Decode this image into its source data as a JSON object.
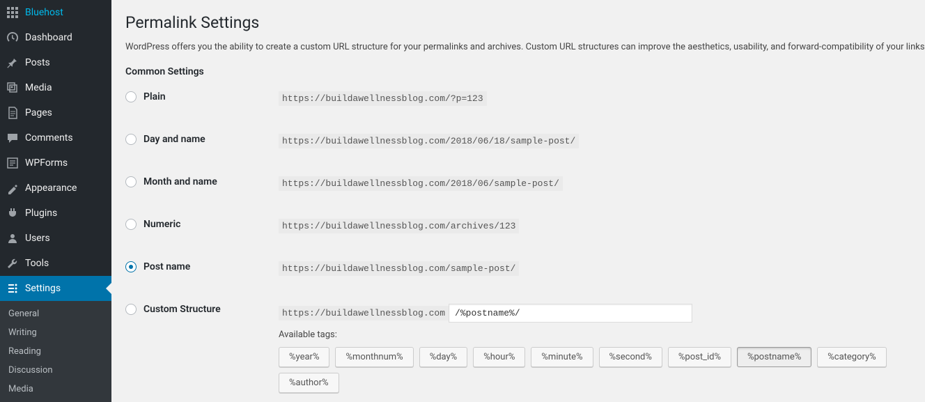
{
  "sidebar": {
    "items": [
      {
        "label": "Bluehost",
        "icon": "grid"
      },
      {
        "label": "Dashboard",
        "icon": "dashboard"
      },
      {
        "label": "Posts",
        "icon": "pin"
      },
      {
        "label": "Media",
        "icon": "media"
      },
      {
        "label": "Pages",
        "icon": "pages"
      },
      {
        "label": "Comments",
        "icon": "comments"
      },
      {
        "label": "WPForms",
        "icon": "forms"
      },
      {
        "label": "Appearance",
        "icon": "appearance"
      },
      {
        "label": "Plugins",
        "icon": "plugins"
      },
      {
        "label": "Users",
        "icon": "users"
      },
      {
        "label": "Tools",
        "icon": "tools"
      },
      {
        "label": "Settings",
        "icon": "settings",
        "active": true
      }
    ],
    "submenu": [
      {
        "label": "General"
      },
      {
        "label": "Writing"
      },
      {
        "label": "Reading"
      },
      {
        "label": "Discussion"
      },
      {
        "label": "Media"
      }
    ]
  },
  "main": {
    "title": "Permalink Settings",
    "description": "WordPress offers you the ability to create a custom URL structure for your permalinks and archives. Custom URL structures can improve the aesthetics, usability, and forward-compatibility of your links. A",
    "section_heading": "Common Settings",
    "options": [
      {
        "label": "Plain",
        "sample": "https://buildawellnessblog.com/?p=123",
        "checked": false
      },
      {
        "label": "Day and name",
        "sample": "https://buildawellnessblog.com/2018/06/18/sample-post/",
        "checked": false
      },
      {
        "label": "Month and name",
        "sample": "https://buildawellnessblog.com/2018/06/sample-post/",
        "checked": false
      },
      {
        "label": "Numeric",
        "sample": "https://buildawellnessblog.com/archives/123",
        "checked": false
      },
      {
        "label": "Post name",
        "sample": "https://buildawellnessblog.com/sample-post/",
        "checked": true
      },
      {
        "label": "Custom Structure",
        "prefix": "https://buildawellnessblog.com",
        "value": "/%postname%/",
        "checked": false
      }
    ],
    "available_tags_label": "Available tags:",
    "tags": [
      {
        "label": "%year%",
        "active": false
      },
      {
        "label": "%monthnum%",
        "active": false
      },
      {
        "label": "%day%",
        "active": false
      },
      {
        "label": "%hour%",
        "active": false
      },
      {
        "label": "%minute%",
        "active": false
      },
      {
        "label": "%second%",
        "active": false
      },
      {
        "label": "%post_id%",
        "active": false
      },
      {
        "label": "%postname%",
        "active": true
      },
      {
        "label": "%category%",
        "active": false
      },
      {
        "label": "%author%",
        "active": false
      }
    ]
  }
}
